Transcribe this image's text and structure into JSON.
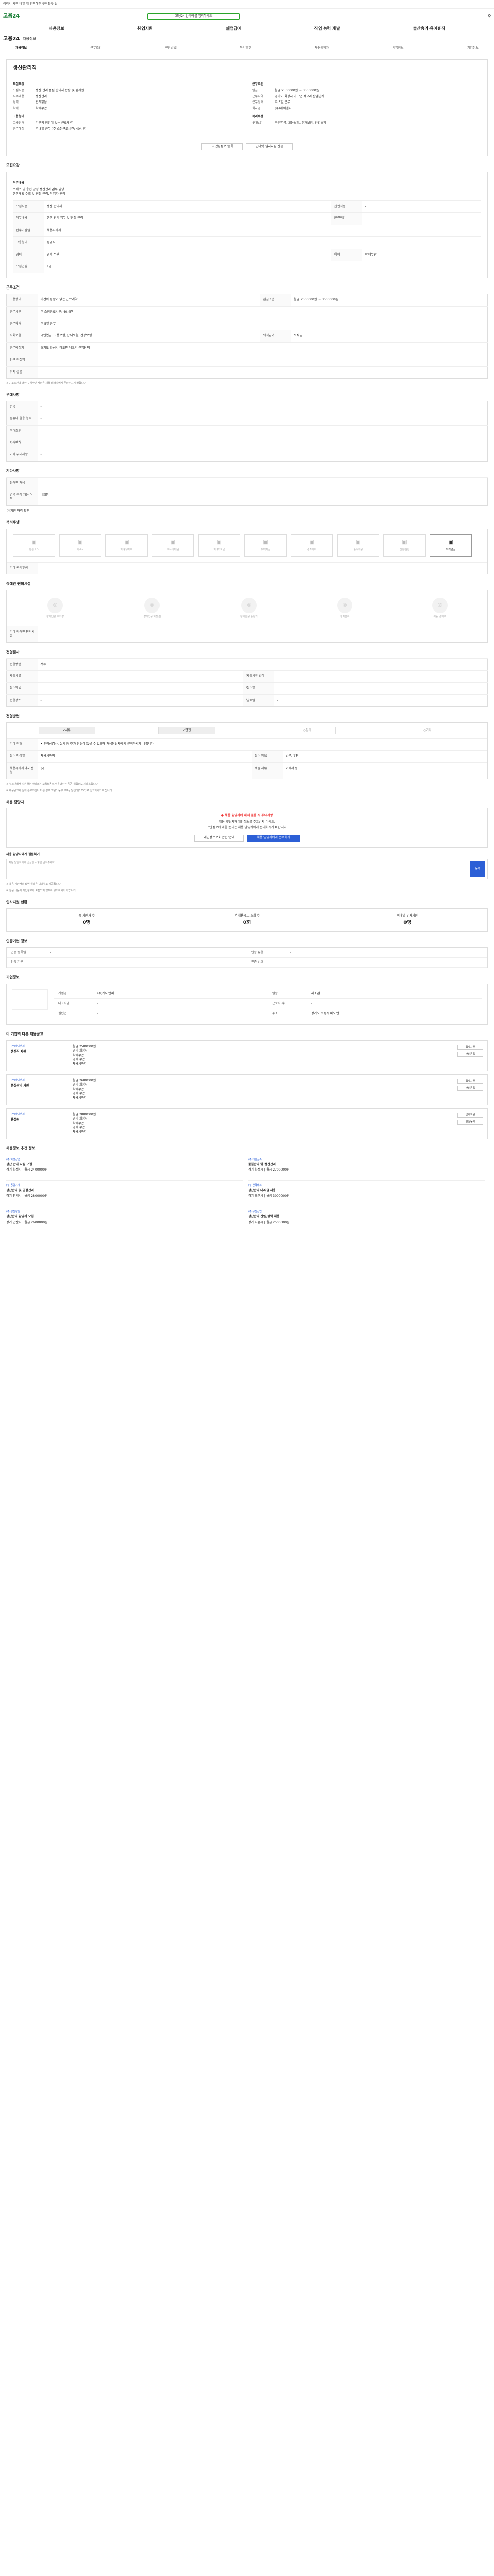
{
  "topbar": {
    "text": "이력서 사진 바뀔 때 편안해진 구직활동 팁"
  },
  "header": {
    "logo": "고용24",
    "search_placeholder": "고용24 검색어를 입력하세요",
    "right": "Q"
  },
  "gnb": [
    "채용정보",
    "취업지원",
    "실업급여",
    "직업 능력 개발",
    "출산휴가·육아휴직"
  ],
  "logo2": {
    "brand": "고용24",
    "tag": "채용정보"
  },
  "tabs": [
    "채용정보",
    "근무조건",
    "전형방법",
    "복리후생",
    "채용담당자",
    "기업정보",
    "기업정보"
  ],
  "job": {
    "title": "생산관리직",
    "section_left": "모집요강",
    "section_right": "근무조건",
    "left": [
      {
        "k": "모집직종",
        "v": "생산 관리·품질 관리자 반장 및 검사원"
      },
      {
        "k": "직무내용",
        "v": "생산관리"
      },
      {
        "k": "경력",
        "v": "관계없음"
      },
      {
        "k": "학력",
        "v": "학력무관"
      }
    ],
    "right": [
      {
        "k": "임금",
        "v": "월급 2500000원 ~ 3500000원"
      },
      {
        "k": "근무지역",
        "v": "경기도 화성시 마도면 석교리 산업단지"
      },
      {
        "k": "근무형태",
        "v": "주 5일 근무"
      },
      {
        "k": "회사명",
        "v": "(주)케이앤피"
      }
    ],
    "subhead_left": "고용형태",
    "left2": [
      {
        "k": "고용형태",
        "v": "기간의 정함이 없는 근로계약"
      },
      {
        "k": "근무예정",
        "v": "주 5일 근무 (주 소정근로시간: 40시간)"
      }
    ],
    "subhead_right": "복리후생",
    "right2": [
      {
        "k": "4대보험",
        "v": "국민연금, 고용보험, 산재보험, 건강보험"
      }
    ],
    "btn_bookmark": "관심정보 등록",
    "btn_apply": "인터넷 입사지원 신청"
  },
  "detail_section": "모집요강",
  "detail_sub": "직무내용",
  "detail_text": [
    "프레스 및 용접 공정 생산관리 업무 담당",
    "생산계획 수립 및 현장 관리, 작업자 관리"
  ],
  "detail_table": [
    {
      "k": "모집직종",
      "v": "생산 관리자",
      "k2": "관련직종",
      "v2": "-"
    },
    {
      "k": "직무내용",
      "v": "생산 관리 업무 및 현장 관리",
      "k2": "관련직업",
      "v2": "-"
    },
    {
      "k": "접수마감일",
      "v": "채용시까지",
      "k2": "",
      "v2": ""
    },
    {
      "k": "고용형태",
      "v": "정규직",
      "k2": "",
      "v2": ""
    },
    {
      "k": "경력",
      "v": "경력 무관",
      "k2": "학력",
      "v2": "학력무관"
    },
    {
      "k": "모집인원",
      "v": "1명",
      "k2": "",
      "v2": ""
    }
  ],
  "work_section": "근무조건",
  "work_table": [
    {
      "k": "고용형태",
      "v": "기간의 정함이 없는 근로계약",
      "k2": "임금조건",
      "v2": "월급 2500000원 ~ 3500000원"
    },
    {
      "k": "근무시간",
      "v": "주 소정근로시간: 40시간",
      "k2": "",
      "v2": ""
    },
    {
      "k": "근무형태",
      "v": "주 5일 근무",
      "k2": "",
      "v2": ""
    },
    {
      "k": "사회보험",
      "v": "국민연금, 고용보험, 산재보험, 건강보험",
      "k2": "퇴직급여",
      "v2": "퇴직금"
    },
    {
      "k": "근무예정지",
      "v": "경기도 화성시 마도면 석교리 산업단지",
      "k2": "",
      "v2": ""
    },
    {
      "k": "인근 전철역",
      "v": "-",
      "k2": "",
      "v2": ""
    },
    {
      "k": "위치 설명",
      "v": "-",
      "k2": "",
      "v2": ""
    }
  ],
  "work_note": "※ 근로조건에 대한 구체적인 사항은 채용 담당자에게 문의하시기 바랍니다.",
  "pref_section": "우대사항",
  "pref_table": [
    {
      "k": "전공",
      "v": "-"
    },
    {
      "k": "컴퓨터 활용 능력",
      "v": "-"
    },
    {
      "k": "우대조건",
      "v": "-"
    },
    {
      "k": "자격면허",
      "v": "-"
    },
    {
      "k": "기타 우대사항",
      "v": "-"
    }
  ],
  "etc_section": "기타사항",
  "etc_table": [
    {
      "k": "장애인 채용",
      "v": "-"
    },
    {
      "k": "병역 특례 채용 여부",
      "v": "비희망"
    }
  ],
  "etc_link": "지원 자격 확인",
  "welfare_section": "복리후생",
  "welfare_icons": [
    {
      "label": "통근버스",
      "on": false
    },
    {
      "label": "기숙사",
      "on": false
    },
    {
      "label": "차량유지비",
      "on": false
    },
    {
      "label": "교육비지원",
      "on": false
    },
    {
      "label": "자녀학자금",
      "on": false
    },
    {
      "label": "주택자금",
      "on": false
    },
    {
      "label": "경조사비",
      "on": false
    },
    {
      "label": "중식제공",
      "on": false
    },
    {
      "label": "건강검진",
      "on": false
    },
    {
      "label": "퇴직연금",
      "on": true
    }
  ],
  "welfare_etc_label": "기타 복리후생",
  "welfare_etc_value": "-",
  "disabled_section": "장애인 편의시설",
  "disabled_icons": [
    "장애인용 주차장",
    "장애인용 화장실",
    "장애인용 승강기",
    "점자블록",
    "이동 경사로"
  ],
  "disabled_etc_label": "기타 장애인 편의시설",
  "disabled_etc_value": "-",
  "process_section": "전형절차",
  "process_table": [
    {
      "k": "전형방법",
      "v": "서류",
      "k2": "",
      "v2": ""
    },
    {
      "k": "제출서류",
      "v": "-",
      "k2": "제출서류 양식",
      "v2": "-"
    },
    {
      "k": "접수방법",
      "v": "-",
      "k2": "접수일",
      "v2": "-"
    },
    {
      "k": "전형장소",
      "v": "-",
      "k2": "발표일",
      "v2": "-"
    }
  ],
  "method_section": "전형방법",
  "methods": [
    {
      "label": "서류",
      "on": true
    },
    {
      "label": "면접",
      "on": true
    },
    {
      "label": "필기",
      "on": false
    },
    {
      "label": "기타",
      "on": false
    }
  ],
  "method_etc_label": "기타 전형",
  "method_etc_text": "• 인적성검사, 실기 등 추가 전형이 있을 수 있으며 채용담당자에게 문의하시기 바랍니다.",
  "apply_box": {
    "k1": "접수 마감일",
    "v1": "채용시까지",
    "k2": "채용시까지 추가전형",
    "v2": "(-)",
    "k3": "접수 방법",
    "v3": "방문, 우편",
    "k4": "제출 서류",
    "v4": "이력서 등"
  },
  "notes": [
    "※ 워크넷에서 지원하는 서비스는 고용노동부가 운영하는 공공 취업정보 서비스입니다.",
    "※ 채용공고와 실제 근로조건이 다른 경우 고용노동부 고객상담센터(1350)로 신고하시기 바랍니다."
  ],
  "contact_section": "채용 담당자",
  "contact_box": {
    "title": "● 채용 담당자에 대해 물음 시 주의사항",
    "desc1": "채용 담당자와 개인정보를 주고받지 마세요.",
    "desc2": "구인정보에 대한 문의는 채용 담당자에게 문의하시기 바랍니다.",
    "btn1": "개인정보보호 관련 안내",
    "btn2": "채용 담당자에게 문의하기"
  },
  "chat_section": "채용 담당자에게 질문하기",
  "chat_hint": "채용 담당자에게 궁금한 사항을 남겨주세요.",
  "chat_send": "등록",
  "chat_notes": [
    "※ 채용 담당자의 답변 알림은 이메일로 제공됩니다.",
    "※ 질문 내용에 개인정보가 포함되지 않도록 유의하시기 바랍니다."
  ],
  "stats_section": "입사지원 현황",
  "stats": [
    {
      "k": "총 지원자 수",
      "v": "0명"
    },
    {
      "k": "본 채용공고 조회 수",
      "v": "0회"
    },
    {
      "k": "이메일 입사지원",
      "v": "0명"
    }
  ],
  "reg_section": "인증기업 정보",
  "reg": [
    {
      "k": "인증 등록일",
      "v": "-"
    },
    {
      "k": "인증 유형",
      "v": "-"
    },
    {
      "k": "인증 기관",
      "v": "-"
    },
    {
      "k": "인증 번호",
      "v": "-"
    }
  ],
  "comp_section": "기업정보",
  "comp": [
    {
      "k": "기업명",
      "v": "(주)케이앤피"
    },
    {
      "k": "업종",
      "v": "제조업"
    },
    {
      "k": "대표자명",
      "v": "-"
    },
    {
      "k": "근로자 수",
      "v": "-"
    },
    {
      "k": "설립년도",
      "v": "-"
    },
    {
      "k": "주소",
      "v": "경기도 화성시 마도면"
    }
  ],
  "related_section": "이 기업의 다른 채용공고",
  "related": [
    {
      "company": "(주)케이앤피",
      "title": "생산직 사원",
      "wage": "월급 2500000원",
      "area": "경기 화성시",
      "edu": "학력무관",
      "career": "경력 무관",
      "date": "채용시까지"
    },
    {
      "company": "(주)케이앤피",
      "title": "품질관리 사원",
      "wage": "월급 2600000원",
      "area": "경기 화성시",
      "edu": "학력무관",
      "career": "경력 무관",
      "date": "채용시까지"
    },
    {
      "company": "(주)케이앤피",
      "title": "용접원",
      "wage": "월급 2800000원",
      "area": "경기 화성시",
      "edu": "학력무관",
      "career": "경력 무관",
      "date": "채용시까지"
    }
  ],
  "related_btn1": "입사지원",
  "related_btn2": "관심등록",
  "hot_section": "채용정보 추천 정보",
  "hot": [
    {
      "c": "(주)화성산업",
      "t": "생산 관리 사원 모집",
      "m": "경기 화성시 | 월급 2400000원"
    },
    {
      "c": "(주)대한금속",
      "t": "품질관리 및 생산관리",
      "m": "경기 화성시 | 월급 2700000원"
    },
    {
      "c": "(주)동양기계",
      "t": "생산관리 및 공정관리",
      "m": "경기 평택시 | 월급 2800000원"
    },
    {
      "c": "(주)한국테크",
      "t": "생산관리 대리급 채용",
      "m": "경기 오산시 | 월급 3000000원"
    },
    {
      "c": "(주)성진정밀",
      "t": "생산관리 담당자 모집",
      "m": "경기 안산시 | 월급 2600000원"
    },
    {
      "c": "(주)우진산업",
      "t": "생산관리 신입/경력 채용",
      "m": "경기 시흥시 | 월급 2500000원"
    }
  ]
}
